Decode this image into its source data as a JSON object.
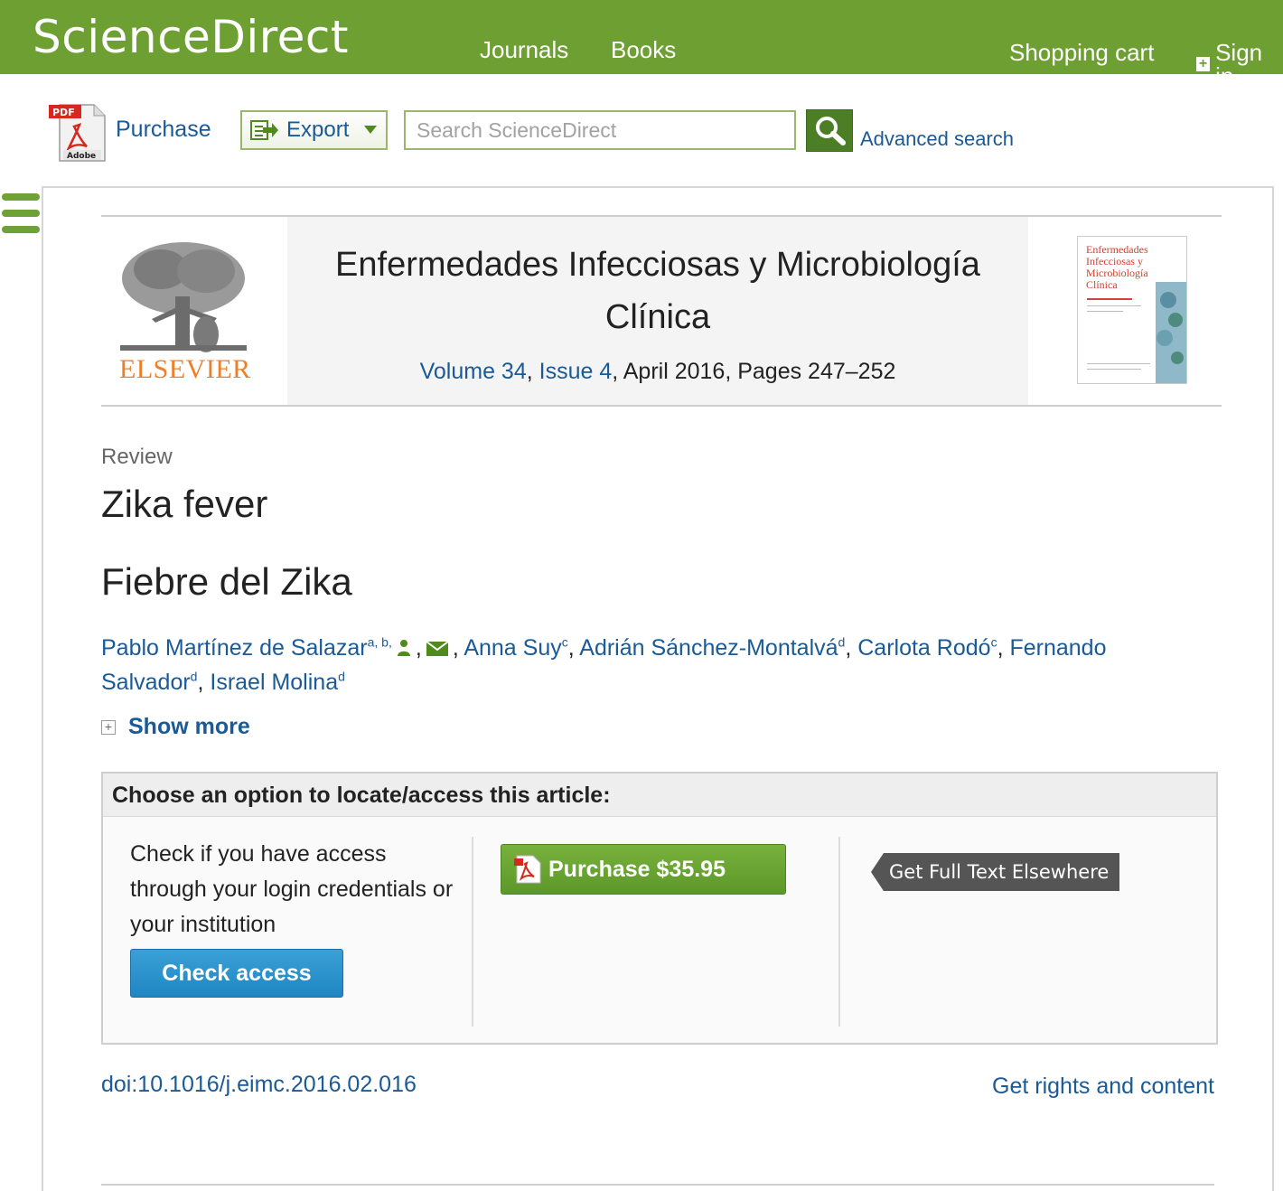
{
  "header": {
    "brand": "ScienceDirect",
    "nav": {
      "journals": "Journals",
      "books": "Books",
      "cart": "Shopping cart",
      "sign_in": "Sign in"
    },
    "brand_color": "#6e9f33"
  },
  "toolbar": {
    "purchase_label": "Purchase",
    "pdf_icon_labels": {
      "top": "PDF",
      "bottom": "Adobe"
    },
    "export_label": "Export",
    "search_placeholder": "Search ScienceDirect",
    "advanced_search": "Advanced search"
  },
  "journal": {
    "publisher": "ELSEVIER",
    "title": "Enfermedades Infecciosas y Microbiología Clínica",
    "volume": "Volume 34",
    "issue": "Issue 4",
    "date_pages": ", April 2016, Pages 247–252",
    "cover_title": "Enfermedades Infecciosas y Microbiología Clínica"
  },
  "article": {
    "type": "Review",
    "title_en": "Zika fever",
    "title_es": "Fiebre del Zika",
    "authors": [
      {
        "name": "Pablo Martínez de Salazar",
        "sup": "a, b,"
      },
      {
        "name": "Anna Suy",
        "sup": "c"
      },
      {
        "name": "Adrián Sánchez-Montalvá",
        "sup": "d"
      },
      {
        "name": "Carlota Rodó",
        "sup": "c"
      },
      {
        "name": "Fernando Salvador",
        "sup": "d"
      },
      {
        "name": "Israel Molina",
        "sup": "d"
      }
    ],
    "show_more": "Show more",
    "doi": "doi:10.1016/j.eimc.2016.02.016",
    "rights": "Get rights and content"
  },
  "access": {
    "heading": "Choose an option to locate/access this article:",
    "check_text": "Check if you have access through your login credentials or your institution",
    "check_button": "Check access",
    "purchase_button": "Purchase $35.95",
    "fulltext_button": "Get Full Text Elsewhere"
  }
}
